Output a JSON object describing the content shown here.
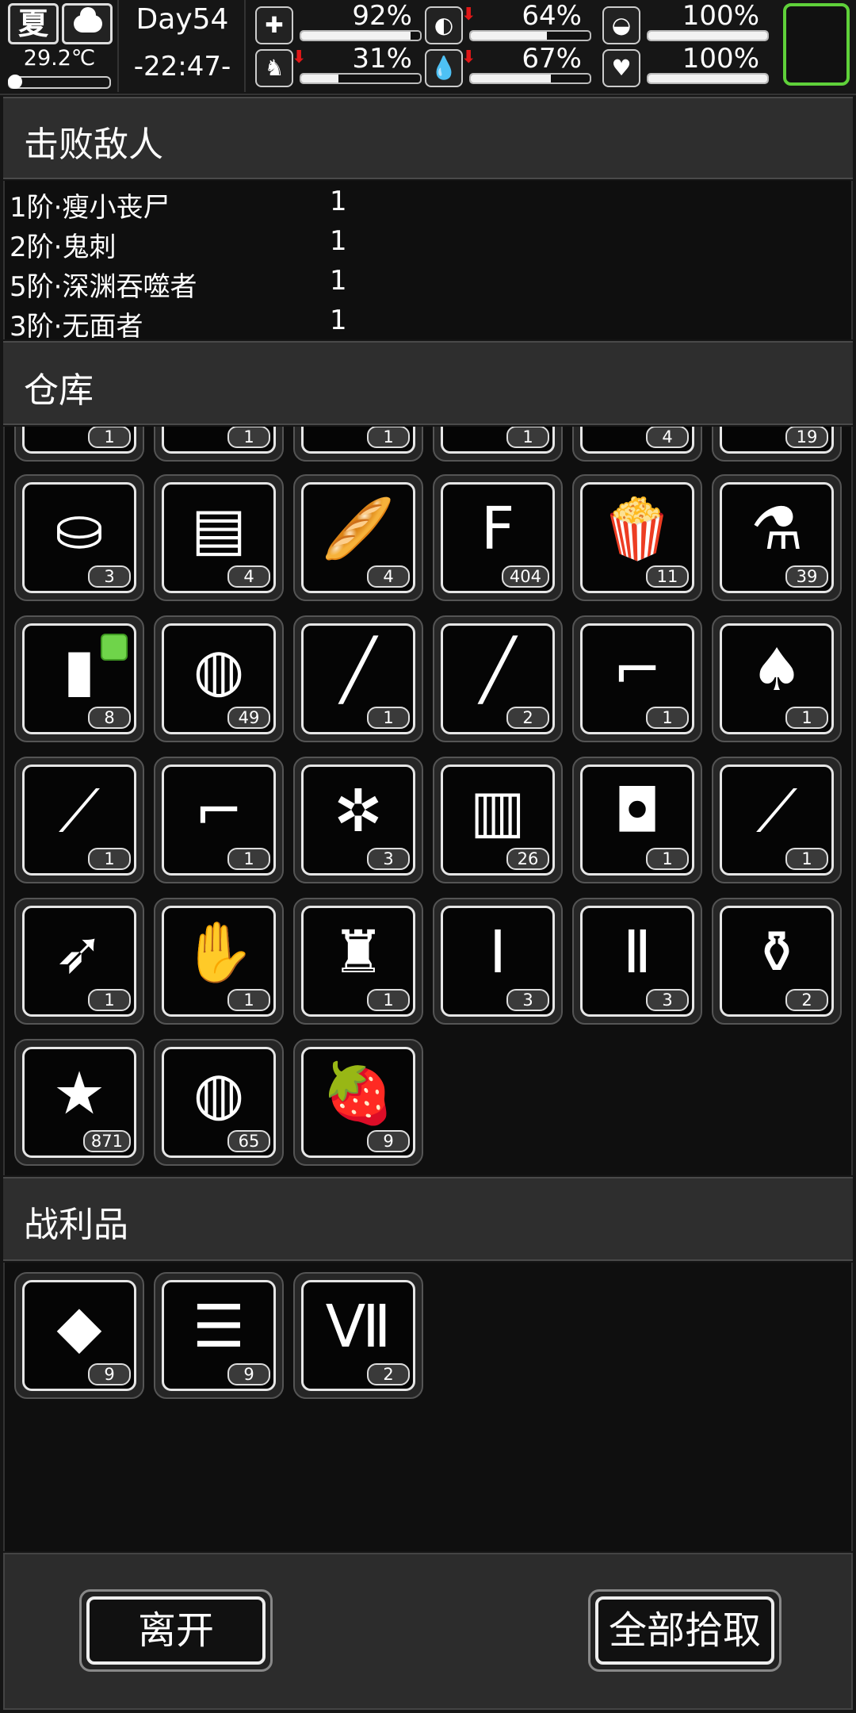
{
  "status": {
    "season": "夏",
    "weather_icon": "cloud-icon",
    "temperature": "29.2℃",
    "day": "Day54",
    "clock": "-22:47-",
    "stats": [
      {
        "name": "health",
        "icon": "medkit-icon",
        "glyph": "✚",
        "value": "92%",
        "fill": 0.92,
        "down": false
      },
      {
        "name": "hunger",
        "icon": "stomach-icon",
        "glyph": "◐",
        "value": "64%",
        "fill": 0.64,
        "down": true
      },
      {
        "name": "mood",
        "icon": "pill-icon",
        "glyph": "◒",
        "value": "100%",
        "fill": 1.0,
        "down": false
      },
      {
        "name": "stamina",
        "icon": "boot-icon",
        "glyph": "♞",
        "value": "31%",
        "fill": 0.31,
        "down": true
      },
      {
        "name": "thirst",
        "icon": "water-drop-icon",
        "glyph": "💧",
        "value": "67%",
        "fill": 0.67,
        "down": true
      },
      {
        "name": "sanity",
        "icon": "heart-icon",
        "glyph": "♥",
        "value": "100%",
        "fill": 1.0,
        "down": false
      }
    ],
    "down_arrow": "⬇"
  },
  "enemies_section": {
    "title": "击败敌人",
    "rows": [
      {
        "name": "1阶·瘦小丧尸",
        "count": "1"
      },
      {
        "name": "2阶·鬼刺",
        "count": "1"
      },
      {
        "name": "5阶·深渊吞噬者",
        "count": "1"
      },
      {
        "name": "3阶·无面者",
        "count": "1"
      }
    ]
  },
  "warehouse_section": {
    "title": "仓库",
    "partial_row": [
      {
        "icon": "partial-item-icon",
        "glyph": "◯",
        "qty": "1"
      },
      {
        "icon": "partial-item-icon",
        "glyph": "●",
        "qty": "1"
      },
      {
        "icon": "partial-item-icon",
        "glyph": "◠",
        "qty": "1"
      },
      {
        "icon": "partial-item-icon",
        "glyph": "▽",
        "qty": "1"
      },
      {
        "icon": "banana-icon",
        "glyph": "◡",
        "qty": "4"
      },
      {
        "icon": "herb-icon",
        "glyph": "♣",
        "qty": "19"
      }
    ],
    "items": [
      {
        "icon": "bucket-icon",
        "glyph": "⛀",
        "qty": "3"
      },
      {
        "icon": "cash-bundle-icon",
        "glyph": "▤",
        "qty": "4"
      },
      {
        "icon": "bread-icon",
        "glyph": "🥖",
        "qty": "4"
      },
      {
        "icon": "flour-bag-icon",
        "glyph": "F",
        "qty": "404"
      },
      {
        "icon": "popcorn-icon",
        "glyph": "🍿",
        "qty": "11"
      },
      {
        "icon": "flask-icon",
        "glyph": "⚗",
        "qty": "39"
      },
      {
        "icon": "fuel-canister-icon",
        "glyph": "▮",
        "qty": "8",
        "tag": true
      },
      {
        "icon": "net-helmet-icon",
        "glyph": "◍",
        "qty": "49"
      },
      {
        "icon": "spear-icon",
        "glyph": "╱",
        "qty": "1"
      },
      {
        "icon": "pipe-wrench-icon",
        "glyph": "╱",
        "qty": "2"
      },
      {
        "icon": "pistol-icon",
        "glyph": "⌐",
        "qty": "1"
      },
      {
        "icon": "shovel-icon",
        "glyph": "♠",
        "qty": "1"
      },
      {
        "icon": "machete-icon",
        "glyph": "⟋",
        "qty": "1"
      },
      {
        "icon": "submachine-gun-icon",
        "glyph": "⌐",
        "qty": "1"
      },
      {
        "icon": "flower-icon",
        "glyph": "✲",
        "qty": "3"
      },
      {
        "icon": "beaker-icon",
        "glyph": "▥",
        "qty": "26"
      },
      {
        "icon": "backpack-icon",
        "glyph": "◘",
        "qty": "1"
      },
      {
        "icon": "trowel-icon",
        "glyph": "⟋",
        "qty": "1"
      },
      {
        "icon": "spear-tip-icon",
        "glyph": "➶",
        "qty": "1"
      },
      {
        "icon": "gloves-icon",
        "glyph": "✋",
        "qty": "1"
      },
      {
        "icon": "jacket-icon",
        "glyph": "♜",
        "qty": "1"
      },
      {
        "icon": "test-tube-i-icon",
        "glyph": "Ⅰ",
        "qty": "3"
      },
      {
        "icon": "test-tube-ii-icon",
        "glyph": "Ⅱ",
        "qty": "3"
      },
      {
        "icon": "bottles-icon",
        "glyph": "⚱",
        "qty": "2"
      },
      {
        "icon": "poster-icon",
        "glyph": "★",
        "qty": "871"
      },
      {
        "icon": "net-icon",
        "glyph": "◍",
        "qty": "65"
      },
      {
        "icon": "strawberry-icon",
        "glyph": "🍓",
        "qty": "9"
      }
    ]
  },
  "loot_section": {
    "title": "战利品",
    "items": [
      {
        "icon": "meat-chunk-icon",
        "glyph": "◆",
        "qty": "9"
      },
      {
        "icon": "cloth-icon",
        "glyph": "☰",
        "qty": "9"
      },
      {
        "icon": "test-tube-vii-icon",
        "glyph": "Ⅶ",
        "qty": "2"
      }
    ]
  },
  "actions": {
    "leave_label": "离开",
    "take_all_label": "全部拾取"
  },
  "colors": {
    "accent_green": "#5fd13a",
    "arrow_red": "#e01818"
  }
}
